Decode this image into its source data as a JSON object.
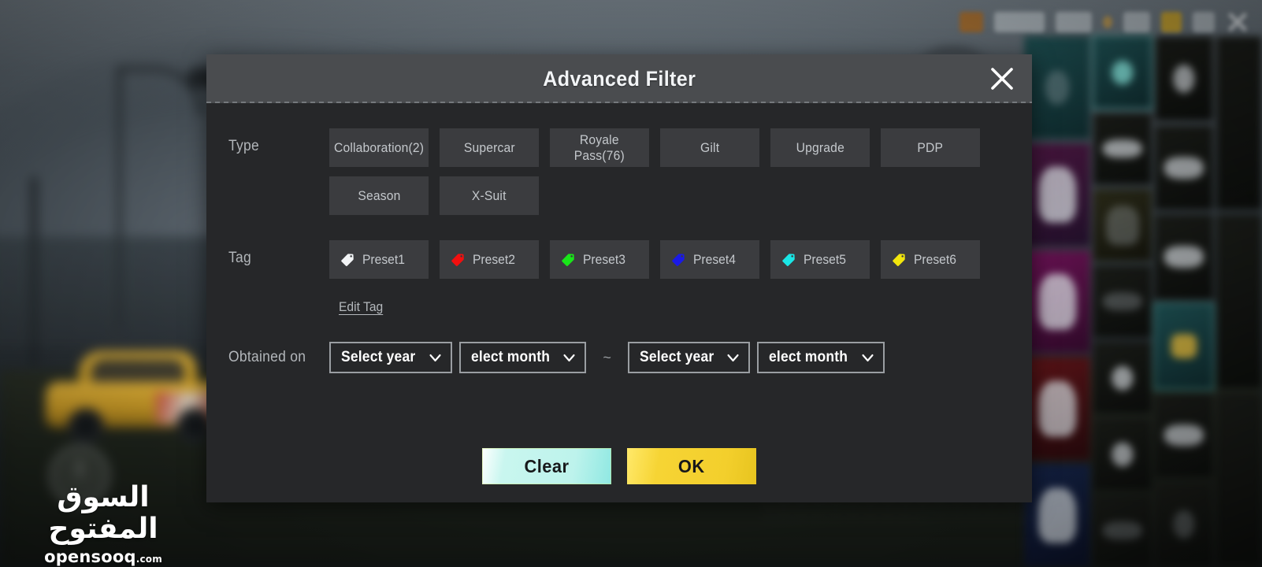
{
  "background": {
    "watermark": {
      "arabic": "السوق المفتوح",
      "brand": "opensooq",
      "tld": ".com"
    }
  },
  "dialog": {
    "title": "Advanced Filter",
    "close_icon": "close-icon",
    "type": {
      "label": "Type",
      "options": [
        {
          "label": "Collaboration(2)"
        },
        {
          "label": "Supercar"
        },
        {
          "label": "Royale\nPass(76)"
        },
        {
          "label": "Gilt"
        },
        {
          "label": "Upgrade"
        },
        {
          "label": "PDP"
        },
        {
          "label": "Season"
        },
        {
          "label": "X-Suit"
        }
      ]
    },
    "tag": {
      "label": "Tag",
      "edit_label": "Edit Tag",
      "options": [
        {
          "label": "Preset1",
          "color": "#f2f4f6"
        },
        {
          "label": "Preset2",
          "color": "#f20f0f"
        },
        {
          "label": "Preset3",
          "color": "#19e619"
        },
        {
          "label": "Preset4",
          "color": "#1a1ae6"
        },
        {
          "label": "Preset5",
          "color": "#1ae6e6"
        },
        {
          "label": "Preset6",
          "color": "#f2e60d"
        }
      ]
    },
    "obtained": {
      "label": "Obtained on",
      "separator": "~",
      "from_year": "Select year",
      "from_month": "elect month",
      "to_year": "Select year",
      "to_month": "elect month"
    },
    "footer": {
      "clear_label": "Clear",
      "ok_label": "OK"
    }
  },
  "colors": {
    "clear_button": "#bdf3ec",
    "ok_button": "#f3cf2c",
    "dialog_body": "#262729",
    "dialog_header": "#4a4c4f",
    "option_button": "#3b3c3f"
  }
}
